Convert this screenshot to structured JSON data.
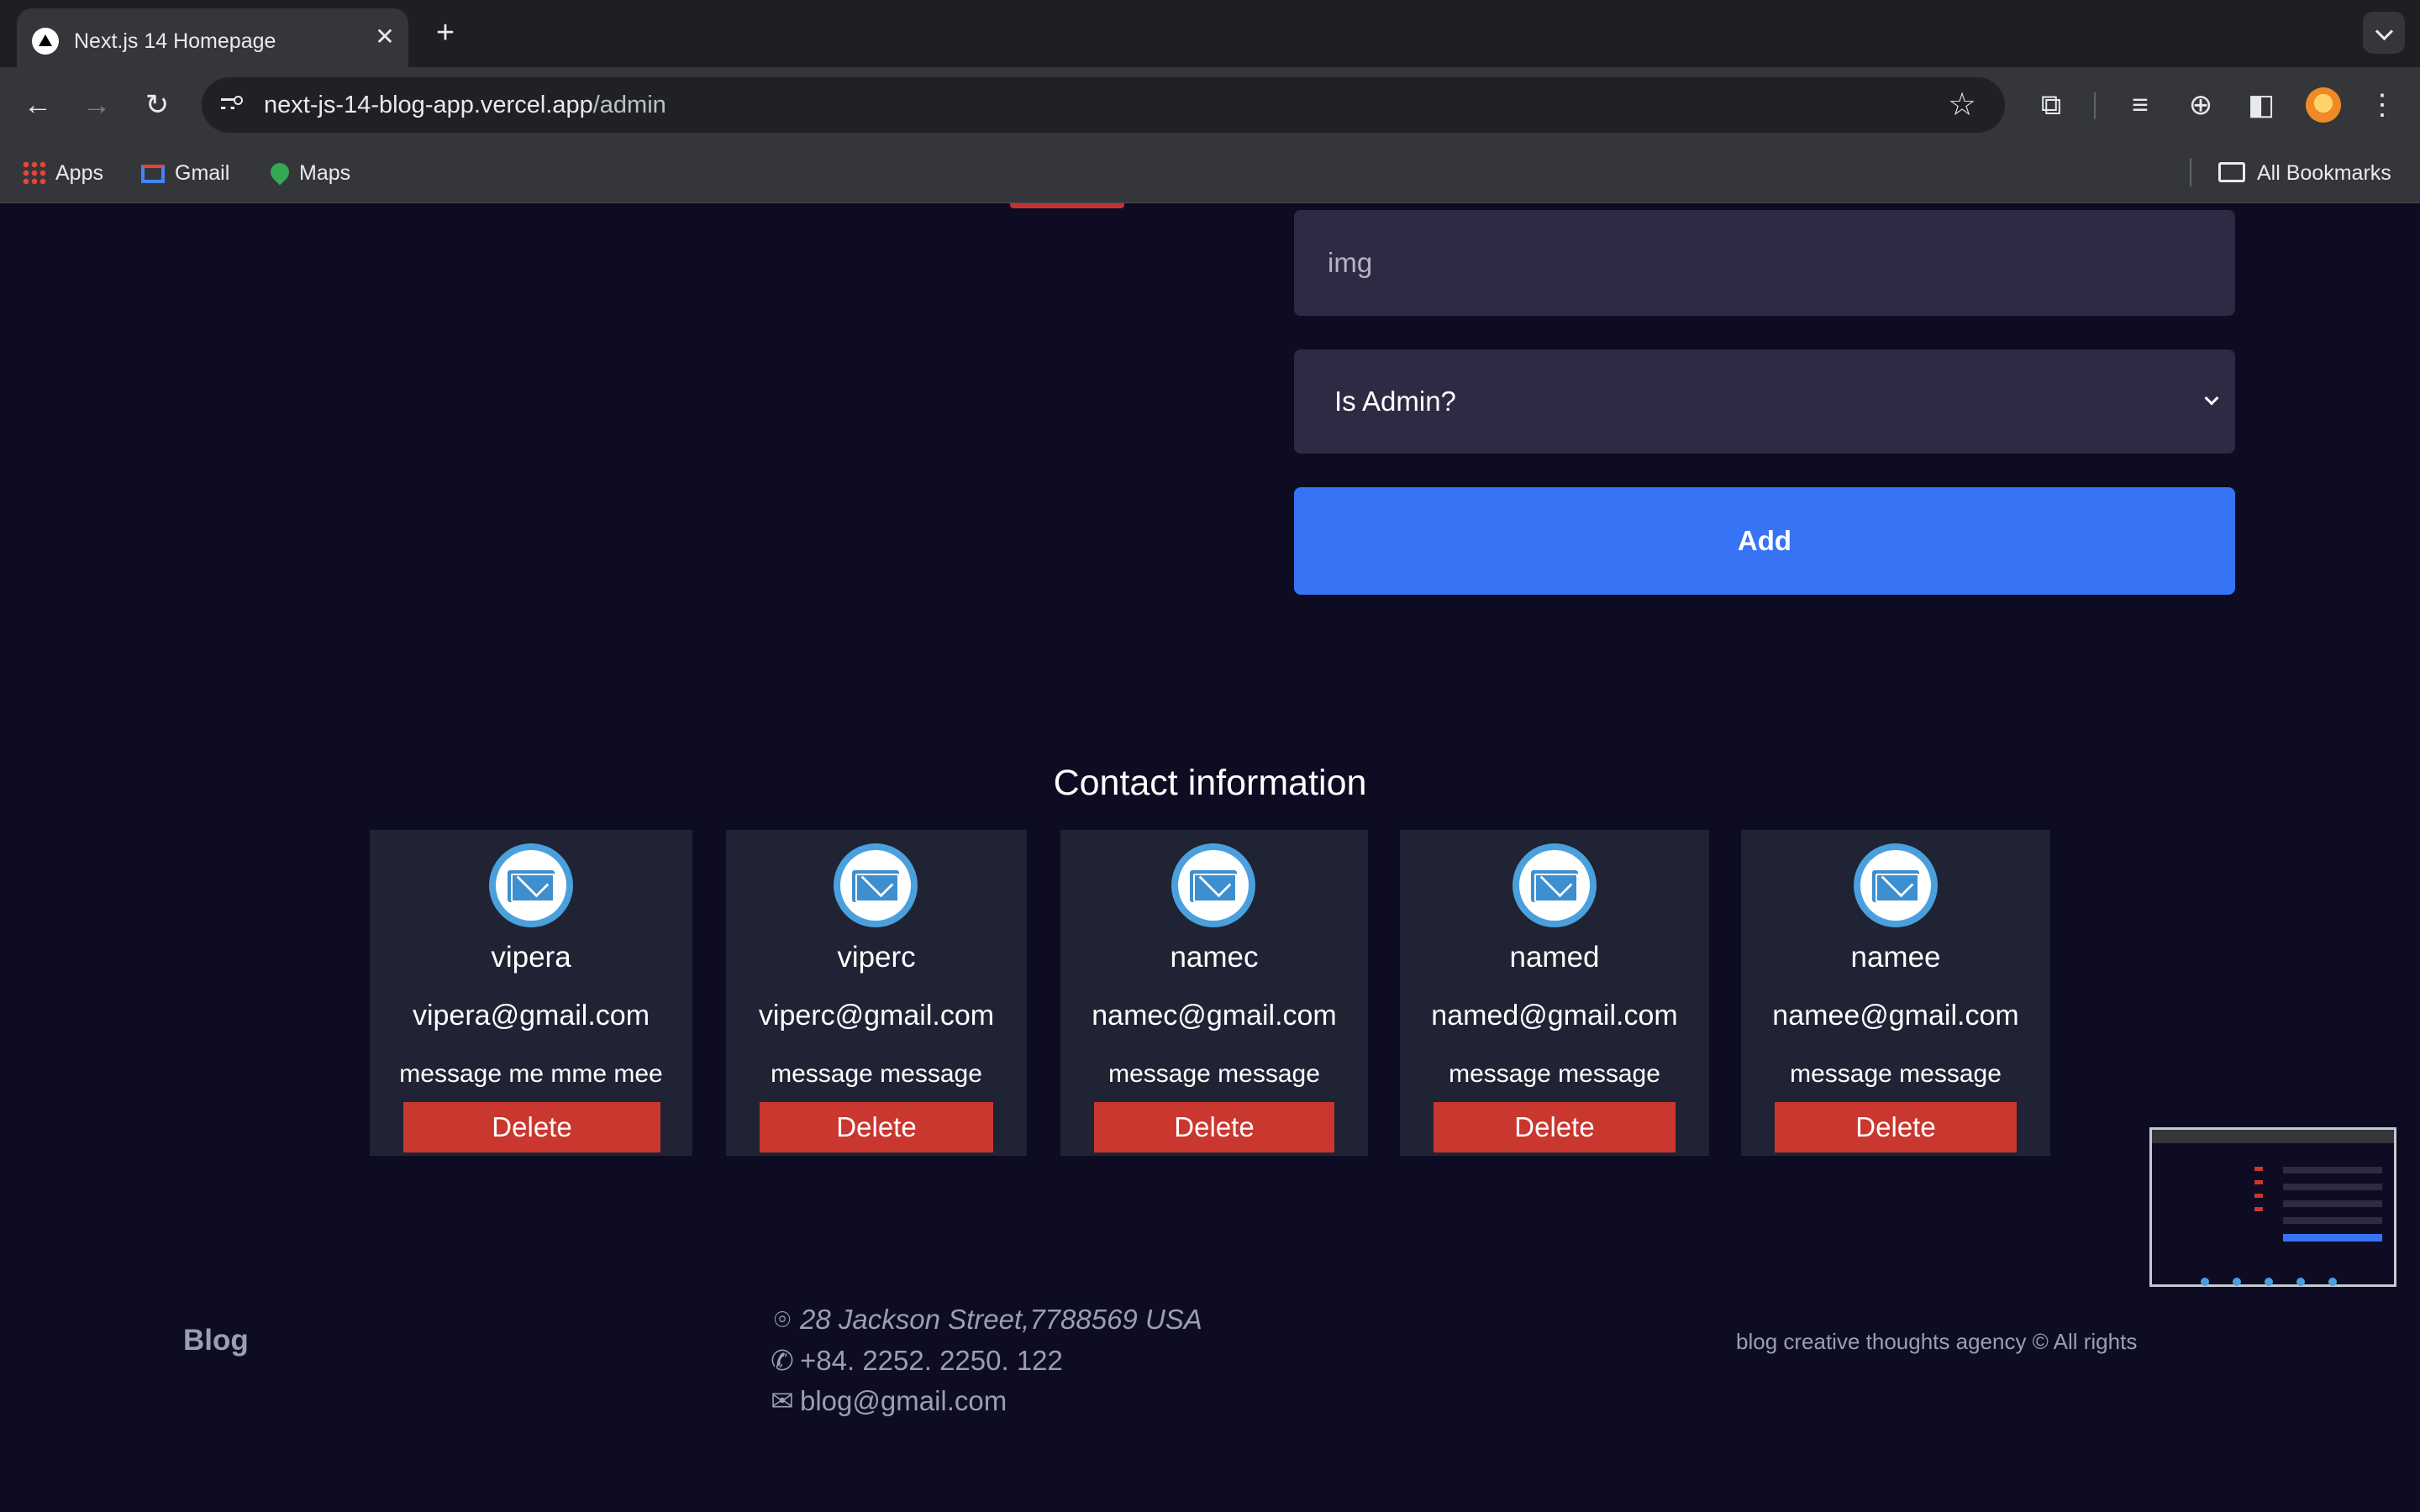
{
  "browser": {
    "tab_title": "Next.js 14 Homepage",
    "url_host": "next-js-14-blog-app.vercel.app",
    "url_path": "/admin",
    "bookmarks": [
      {
        "label": "Apps",
        "icon": "apps-grid-icon"
      },
      {
        "label": "Gmail",
        "icon": "gmail-icon"
      },
      {
        "label": "Maps",
        "icon": "maps-icon"
      }
    ],
    "all_bookmarks_label": "All Bookmarks"
  },
  "admin_form": {
    "img_placeholder": "img",
    "is_admin_select": "Is Admin?",
    "add_label": "Add"
  },
  "contacts": {
    "title": "Contact information",
    "items": [
      {
        "name": "vipera",
        "email": "vipera@gmail.com",
        "message": "message me mme mee",
        "delete_label": "Delete"
      },
      {
        "name": "viperc",
        "email": "viperc@gmail.com",
        "message": "message message",
        "delete_label": "Delete"
      },
      {
        "name": "namec",
        "email": "namec@gmail.com",
        "message": "message message",
        "delete_label": "Delete"
      },
      {
        "name": "named",
        "email": "named@gmail.com",
        "message": "message message",
        "delete_label": "Delete"
      },
      {
        "name": "namee",
        "email": "namee@gmail.com",
        "message": "message message",
        "delete_label": "Delete"
      }
    ]
  },
  "footer": {
    "logo": "Blog",
    "address": "28 Jackson Street,7788569 USA",
    "phone": "+84. 2252. 2250. 122",
    "email": "blog@gmail.com",
    "copyright": "blog creative thoughts agency © All rights"
  },
  "colors": {
    "page_bg": "#0d0c22",
    "card_bg": "#1f2333",
    "input_bg": "#2d2b43",
    "accent_blue": "#3673f5",
    "delete_red": "#c9372f"
  }
}
